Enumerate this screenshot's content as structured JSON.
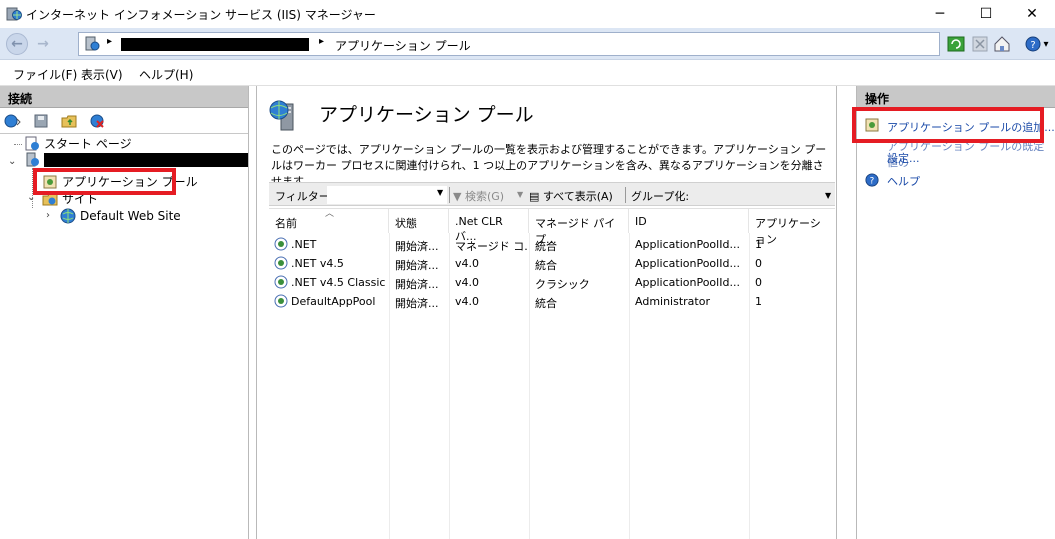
{
  "window": {
    "title": "インターネット インフォメーション サービス (IIS) マネージャー",
    "minimize": "─",
    "maximize": "☐",
    "close": "✕"
  },
  "address": {
    "crumb_sep": "▸",
    "crumb": "アプリケーション プール",
    "help_dropdown": "▾"
  },
  "menu": {
    "items": [
      "ファイル(F)",
      "表示(V)",
      "ヘルプ(H)"
    ]
  },
  "connections": {
    "header": "接続",
    "tree": {
      "start_page": "スタート ページ",
      "app_pools": "アプリケーション プール",
      "sites": "サイト",
      "default_site": "Default Web Site"
    }
  },
  "center": {
    "title": "アプリケーション プール",
    "description": "このページでは、アプリケーション プールの一覧を表示および管理することができます。アプリケーション プールはワーカー プロセスに関連付けられ、1 つ以上のアプリケーションを含み、異なるアプリケーションを分離させます。",
    "filter": {
      "label": "フィルター:",
      "search": "検索(G)",
      "show_all": "すべて表示(A)",
      "group": "グループ化:"
    },
    "columns": [
      "名前",
      "状態",
      ".Net CLR バ...",
      "マネージド パイプ...",
      "ID",
      "アプリケーション"
    ],
    "rows": [
      {
        "name": ".NET",
        "status": "開始済...",
        "clr": "マネージド コ...",
        "pipeline": "統合",
        "id": "ApplicationPoolId...",
        "apps": "1"
      },
      {
        "name": ".NET v4.5",
        "status": "開始済...",
        "clr": "v4.0",
        "pipeline": "統合",
        "id": "ApplicationPoolId...",
        "apps": "0"
      },
      {
        "name": ".NET v4.5 Classic",
        "status": "開始済...",
        "clr": "v4.0",
        "pipeline": "クラシック",
        "id": "ApplicationPoolId...",
        "apps": "0"
      },
      {
        "name": "DefaultAppPool",
        "status": "開始済...",
        "clr": "v4.0",
        "pipeline": "統合",
        "id": "Administrator",
        "apps": "1"
      }
    ]
  },
  "actions": {
    "header": "操作",
    "add_pool": "アプリケーション プールの追加...",
    "defaults_line1": "アプリケーション プールの既定値の",
    "defaults_line2": "設定...",
    "help": "ヘルプ"
  },
  "colors": {
    "highlight": "#e51c23",
    "link": "#1a4aa8",
    "panel_header": "#c8c8c8",
    "address_bg": "#dce6f4"
  }
}
